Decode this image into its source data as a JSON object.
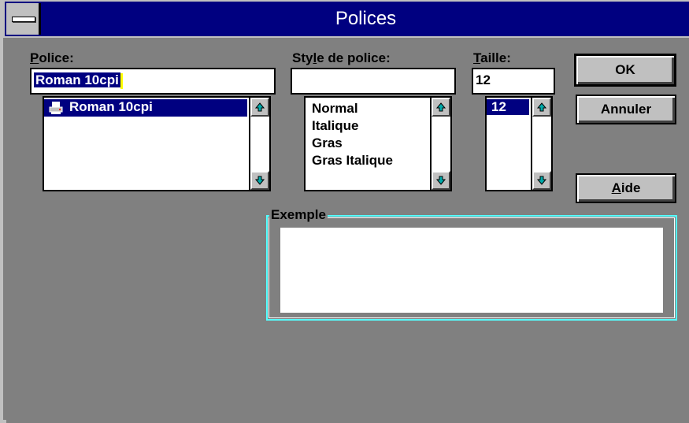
{
  "window": {
    "title": "Polices"
  },
  "font": {
    "label_pre": "",
    "label_mnemonic": "P",
    "label_post": "olice:",
    "value": "Roman 10cpi",
    "items": [
      "Roman 10cpi"
    ],
    "item_icon": "printer-icon"
  },
  "style": {
    "label_pre": "Sty",
    "label_mnemonic": "l",
    "label_post": "e de police:",
    "value": "",
    "items": [
      "Normal",
      "Italique",
      "Gras",
      "Gras Italique"
    ]
  },
  "size": {
    "label_pre": "",
    "label_mnemonic": "T",
    "label_post": "aille:",
    "value": "12",
    "items": [
      "12"
    ]
  },
  "buttons": {
    "ok": "OK",
    "cancel": "Annuler",
    "help_mnemonic": "A",
    "help_rest": "ide"
  },
  "sample": {
    "label": "Exemple"
  },
  "colors": {
    "titlebar": "#000080",
    "selection": "#000080",
    "background": "#808080",
    "group_border": "#55ffff"
  }
}
